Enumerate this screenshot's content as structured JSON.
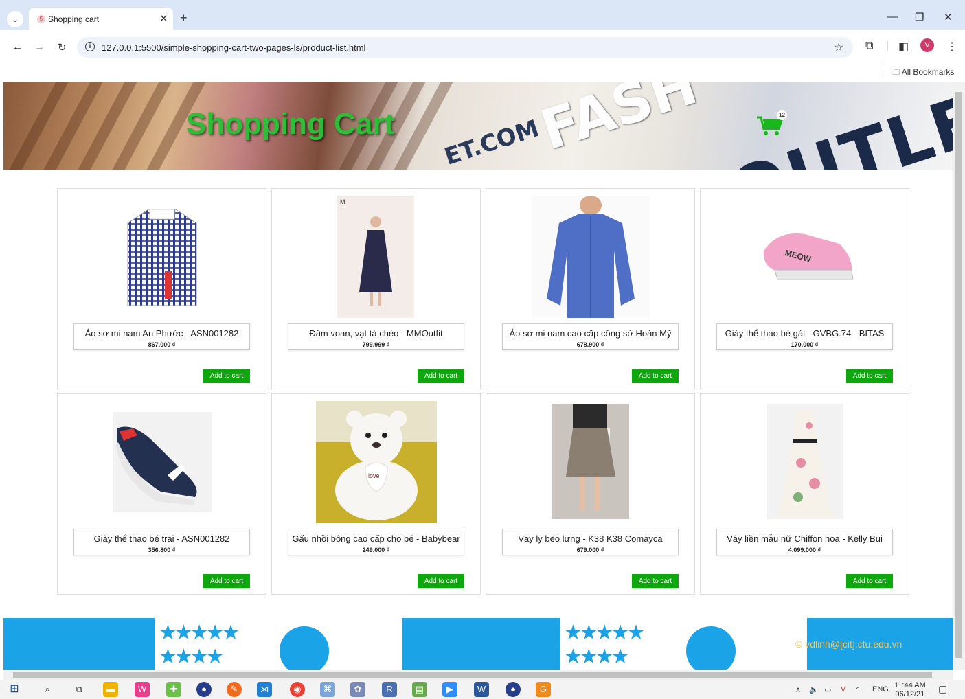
{
  "browser": {
    "tab_title": "Shopping cart",
    "url": "127.0.0.1:5500/simple-shopping-cart-two-pages-ls/product-list.html",
    "bookmarks_label": "All Bookmarks",
    "profile_initial": "V"
  },
  "header": {
    "title": "Shopping Cart",
    "cart_count": "12",
    "bg_text_1": "ET.COM",
    "bg_text_2": "OUTLET",
    "bg_text_3": "FASH"
  },
  "products": [
    {
      "name": "Áo sơ mi nam An Phước - ASN001282",
      "price": "867.000 ₫",
      "button": "Add to cart"
    },
    {
      "name": "Đầm voan, vạt tà chéo - MMOutfit",
      "price": "799.999 ₫",
      "button": "Add to cart"
    },
    {
      "name": "Áo sơ mi nam cao cấp công sở Hoàn Mỹ",
      "price": "678.900 ₫",
      "button": "Add to cart"
    },
    {
      "name": "Giày thể thao bé gái - GVBG.74 - BITAS",
      "price": "170.000 ₫",
      "button": "Add to cart"
    },
    {
      "name": "Giày thể thao bé trai - ASN001282",
      "price": "356.800 ₫",
      "button": "Add to cart"
    },
    {
      "name": "Gấu nhồi bông cao cấp cho bé - Babybear",
      "price": "249.000 ₫",
      "button": "Add to cart"
    },
    {
      "name": "Váy ly bèo lưng - K38 K38 Comayca",
      "price": "679.000 ₫",
      "button": "Add to cart"
    },
    {
      "name": "Váy liền mẫu nữ Chiffon hoa - Kelly Bui",
      "price": "4.099.000 ₫",
      "button": "Add to cart"
    }
  ],
  "footer": {
    "text": "© vdlinh@[cit].ctu.edu.vn"
  },
  "taskbar": {
    "lang": "ENG",
    "time": "11:44 AM",
    "date": "06/12/21"
  },
  "colors": {
    "title_green": "#2ebd36",
    "button_green": "#0ea80e",
    "footer_blue": "#1aa3e6",
    "footer_text": "#f0c860"
  }
}
